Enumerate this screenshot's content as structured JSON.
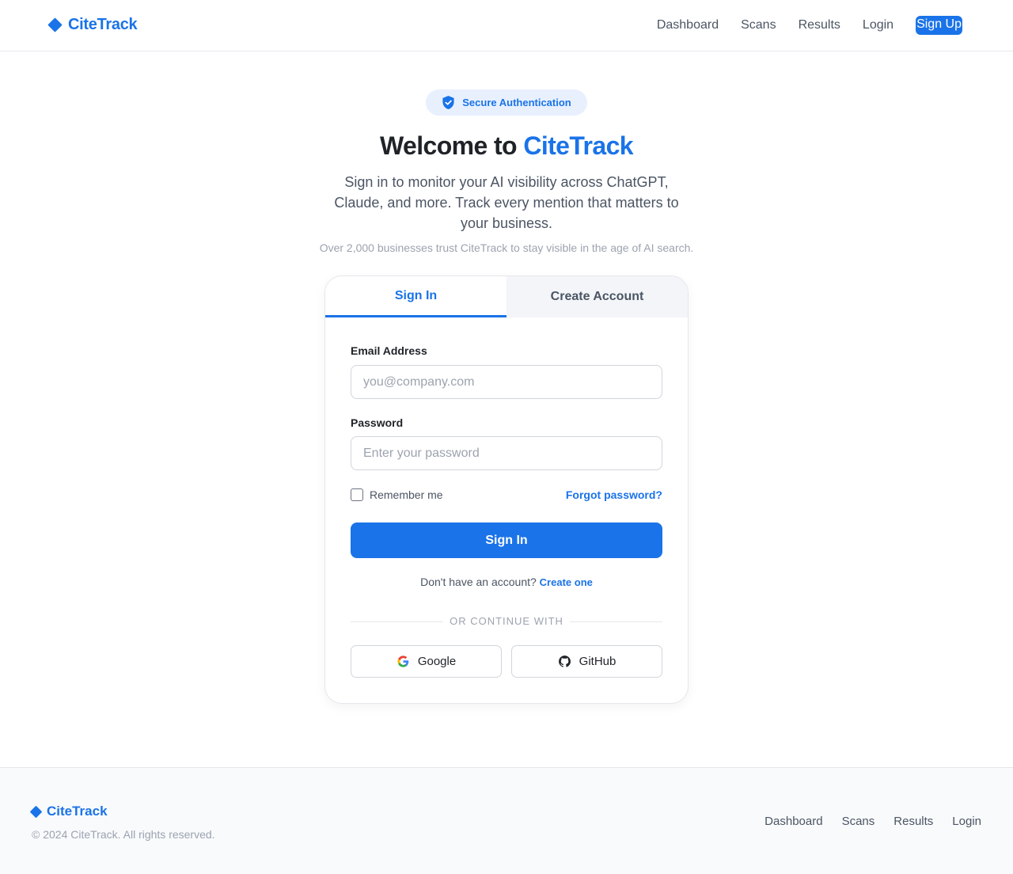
{
  "header": {
    "brand": "CiteTrack",
    "nav": [
      "Dashboard",
      "Scans",
      "Results",
      "Login"
    ],
    "signup_label": "Sign Up"
  },
  "hero": {
    "badge": "Secure Authentication",
    "title_prefix": "Welcome to",
    "title_accent": "CiteTrack",
    "subtitle": "Sign in to monitor your AI visibility across ChatGPT, Claude, and more. Track every mention that matters to your business.",
    "trust": "Over 2,000 businesses trust CiteTrack to stay visible in the age of AI search."
  },
  "card": {
    "tabs": [
      "Sign In",
      "Create Account"
    ],
    "email_label": "Email Address",
    "email_placeholder": "you@company.com",
    "password_label": "Password",
    "password_placeholder": "Enter your password",
    "remember_label": "Remember me",
    "forgot_label": "Forgot password?",
    "submit_label": "Sign In",
    "no_account": "Don't have an account?",
    "create_link": "Create one",
    "divider": "OR CONTINUE WITH",
    "google_label": "Google",
    "github_label": "GitHub"
  },
  "footer": {
    "brand": "CiteTrack",
    "copyright": "© 2024 CiteTrack. All rights reserved.",
    "nav": [
      "Dashboard",
      "Scans",
      "Results",
      "Login"
    ]
  },
  "colors": {
    "accent": "#1a73e8",
    "badge_bg": "#e8f0fe",
    "footer_bg": "#f8fafc"
  },
  "icons": {
    "brand": "diamond-icon",
    "badge": "shield-check-icon",
    "google": "google-icon",
    "github": "github-icon"
  }
}
